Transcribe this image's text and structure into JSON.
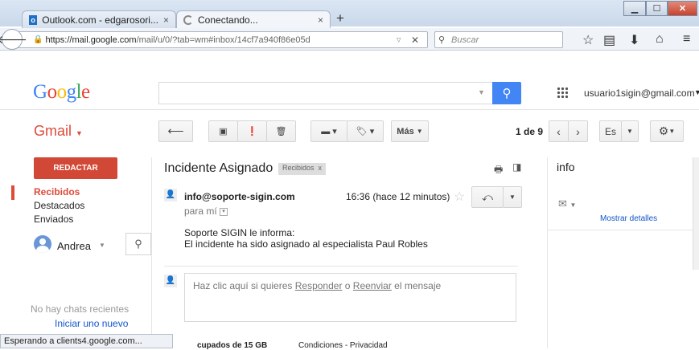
{
  "browser": {
    "tabs": [
      {
        "label": "Outlook.com - edgarosori...",
        "close": "×"
      },
      {
        "label": "Conectando...",
        "close": "×"
      }
    ],
    "new_tab": "+",
    "url_domain": "https://mail.google.com",
    "url_path": "/mail/u/0/?tab=wm#inbox/14cf7a940f86e05d",
    "search_placeholder": "Buscar",
    "status": "Esperando a clients4.google.com..."
  },
  "google": {
    "logo_letters": [
      "G",
      "o",
      "o",
      "g",
      "l",
      "e"
    ],
    "logo_colors": [
      "#4285f4",
      "#ea4335",
      "#fbbc05",
      "#4285f4",
      "#34a853",
      "#ea4335"
    ],
    "account": "usuario1sigin@gmail.com"
  },
  "gmail": {
    "brand": "Gmail",
    "compose": "REDACTAR",
    "more": "Más",
    "page_count": "1 de 9",
    "lang": "Es",
    "sidebar": {
      "items": [
        "Recibidos",
        "Destacados",
        "Enviados"
      ],
      "user": "Andrea",
      "no_chats": "No hay chats recientes",
      "start_new": "Iniciar uno nuevo"
    },
    "message": {
      "subject": "Incidente Asignado",
      "label": "Recibidos",
      "label_x": "x",
      "from": "info@soporte-sigin.com",
      "time": "16:36 (hace 12 minutos)",
      "to": "para mí",
      "body_line1": "Soporte SIGIN le informa:",
      "body_line2": "El incidente ha sido asignado al especialista Paul Robles",
      "reply_prefix": "Haz clic aquí si quieres ",
      "reply_link": "Responder",
      "reply_or": " o ",
      "forward_link": "Reenviar",
      "reply_suffix": " el mensaje"
    },
    "right_panel": {
      "title": "info",
      "details": "Mostrar detalles"
    },
    "footer": {
      "storage": "cupados de 15 GB",
      "links": "Condiciones - Privacidad"
    }
  }
}
